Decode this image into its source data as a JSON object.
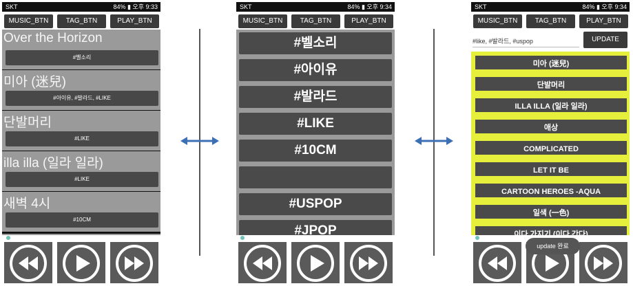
{
  "status": {
    "screen1": {
      "carrier": "SKT",
      "right": "84% ▮ 오후 9:33"
    },
    "screen2": {
      "carrier": "SKT",
      "right": "84% ▮ 오후 9:34"
    },
    "screen3": {
      "carrier": "SKT",
      "right": "84% ▮ 오후 9:34"
    }
  },
  "tabs": {
    "music": "MUSIC_BTN",
    "tag": "TAG_BTN",
    "play": "PLAY_BTN"
  },
  "screen1": {
    "songs": [
      {
        "title": "Over the Horizon",
        "tags": "#벨소리"
      },
      {
        "title": "미아 (迷兒)",
        "tags": "#아이유, #발라드, #LIKE"
      },
      {
        "title": "단발머리",
        "tags": "#LIKE"
      },
      {
        "title": "illa illa (일라 일라)",
        "tags": "#LIKE"
      },
      {
        "title": "새벽 4시",
        "tags": "#10CM"
      }
    ]
  },
  "screen2": {
    "tags": [
      "#벨소리",
      "#아이유",
      "#발라드",
      "#LIKE",
      "#10CM",
      "",
      "#USPOP",
      "#JPOP"
    ]
  },
  "screen3": {
    "input_value": "#like, #발라드, #uspop",
    "update_label": "UPDATE",
    "songs": [
      "미아 (迷兒)",
      "단발머리",
      "ILLA ILLA (일라 일라)",
      "애상",
      "COMPLICATED",
      "LET IT BE",
      "CARTOON HEROES -AQUA",
      "일색 (一色)",
      "이다 가지기 (이다 간다)"
    ],
    "toast": "update 완료"
  },
  "colors": {
    "accent": "#6fc3b8",
    "highlight": "#e6ef3c",
    "arrow": "#3d6fb5",
    "button": "#4a4a4a"
  }
}
